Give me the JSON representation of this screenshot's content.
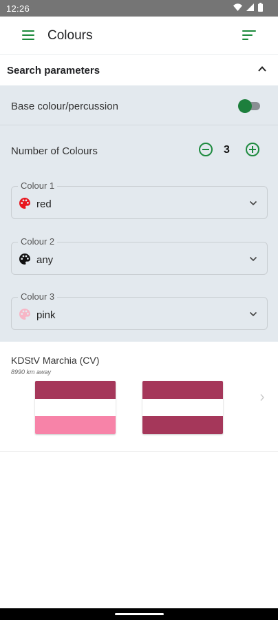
{
  "status_bar": {
    "time": "12:26"
  },
  "app_bar": {
    "title": "Colours"
  },
  "search": {
    "header": "Search parameters",
    "base_toggle_label": "Base colour/percussion",
    "base_toggle_on": true,
    "count_label": "Number of Colours",
    "count_value": "3",
    "colours": [
      {
        "label": "Colour 1",
        "value": "red",
        "palette_color": "#e8171f"
      },
      {
        "label": "Colour 2",
        "value": "any",
        "palette_color": "#111111"
      },
      {
        "label": "Colour 3",
        "value": "pink",
        "palette_color": "#f7b6c6"
      }
    ]
  },
  "results": [
    {
      "name": "KDStV Marchia (CV)",
      "distance": "8990 km away",
      "flags": [
        {
          "stripes": [
            "#a5375a",
            "#ffffff",
            "#f783a8"
          ]
        },
        {
          "stripes": [
            "#a5375a",
            "#ffffff",
            "#a5375a"
          ]
        }
      ]
    }
  ],
  "colors": {
    "accent": "#1d8a3e",
    "panel": "#e3e9ee"
  }
}
